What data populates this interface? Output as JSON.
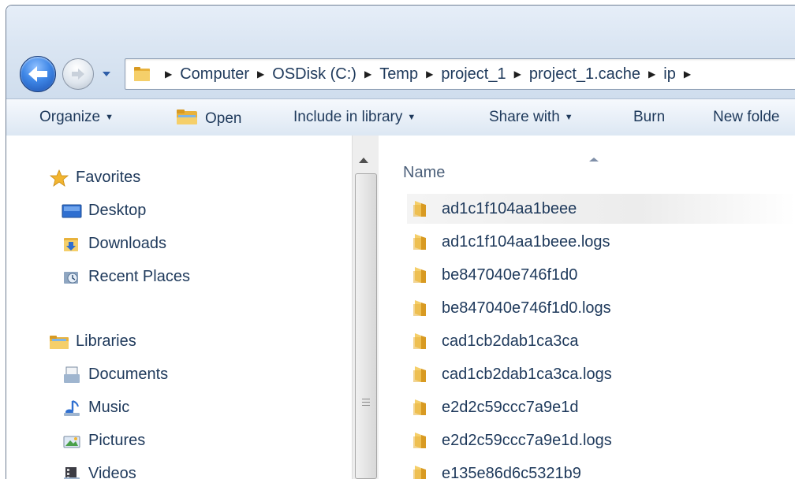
{
  "address_bar": {
    "crumbs": [
      "Computer",
      "OSDisk (C:)",
      "Temp",
      "project_1",
      "project_1.cache",
      "ip"
    ]
  },
  "toolbar": {
    "organize": "Organize",
    "open": "Open",
    "include_in_library": "Include in library",
    "share_with": "Share with",
    "burn": "Burn",
    "new_folder": "New folde"
  },
  "nav_pane": {
    "favorites": {
      "label": "Favorites",
      "items": [
        "Desktop",
        "Downloads",
        "Recent Places"
      ]
    },
    "libraries": {
      "label": "Libraries",
      "items": [
        "Documents",
        "Music",
        "Pictures",
        "Videos"
      ]
    }
  },
  "file_list": {
    "column_name": "Name",
    "files": [
      "ad1c1f104aa1beee",
      "ad1c1f104aa1beee.logs",
      "be847040e746f1d0",
      "be847040e746f1d0.logs",
      "cad1cb2dab1ca3ca",
      "cad1cb2dab1ca3ca.logs",
      "e2d2c59ccc7a9e1d",
      "e2d2c59ccc7a9e1d.logs",
      "e135e86d6c5321b9"
    ]
  },
  "colors": {
    "folder": "#e8b23c",
    "text": "#1e395b",
    "accent": "#3e86e6"
  },
  "icons": {
    "back": "back-arrow-icon",
    "forward": "forward-arrow-icon",
    "folder": "folder-icon",
    "star": "star-icon",
    "desktop": "desktop-icon",
    "downloads": "downloads-icon",
    "recent": "recent-places-icon",
    "libraries": "libraries-icon",
    "documents": "documents-icon",
    "music": "music-icon",
    "pictures": "pictures-icon",
    "videos": "videos-icon"
  }
}
